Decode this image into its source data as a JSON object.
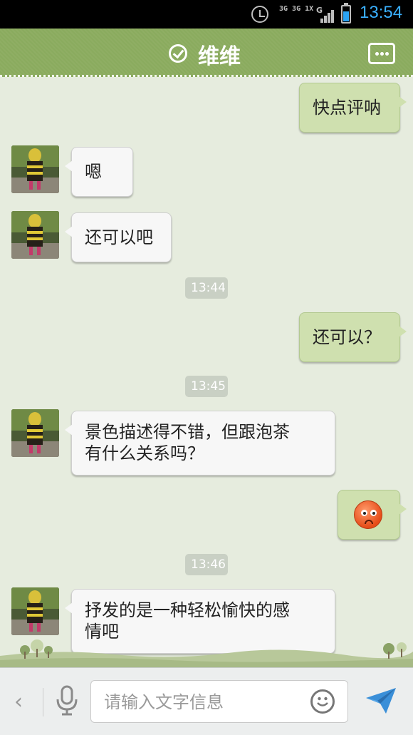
{
  "status_bar": {
    "network_text": "3G 3G 1X",
    "network_type": "G",
    "time": "13:54",
    "signal_bars": 4,
    "battery_level": 0.7,
    "colors": {
      "clock": "#3ab0ff",
      "battery": "#2aa3f5"
    }
  },
  "header": {
    "title": "维维",
    "verified_icon": "check-circle-icon",
    "menu_icon": "more-icon"
  },
  "messages": [
    {
      "type": "text",
      "direction": "out",
      "text": "快点评呐"
    },
    {
      "type": "text",
      "direction": "in",
      "text": "嗯"
    },
    {
      "type": "text",
      "direction": "in",
      "text": "还可以吧"
    },
    {
      "type": "timestamp",
      "text": "13:44"
    },
    {
      "type": "text",
      "direction": "out",
      "text": "还可以？"
    },
    {
      "type": "timestamp",
      "text": "13:45"
    },
    {
      "type": "text",
      "direction": "in",
      "lines": [
        "景色描述得不错，但跟泡茶",
        "有什么关系吗？"
      ]
    },
    {
      "type": "emoji",
      "direction": "out",
      "emoji": "angry-face-icon"
    },
    {
      "type": "timestamp",
      "text": "13:46"
    },
    {
      "type": "text",
      "direction": "in",
      "lines": [
        "抒发的是一种轻松愉快的感",
        "情吧"
      ]
    }
  ],
  "input_bar": {
    "back_icon": "chevron-left-icon",
    "voice_icon": "microphone-icon",
    "placeholder": "请输入文字信息",
    "emoji_icon": "smiley-icon",
    "send_icon": "send-icon"
  },
  "colors": {
    "chat_background": "#e6ecde",
    "header": "#8aab5e",
    "outgoing_bubble": "#cfe0af",
    "incoming_bubble": "#f7f7f7"
  }
}
